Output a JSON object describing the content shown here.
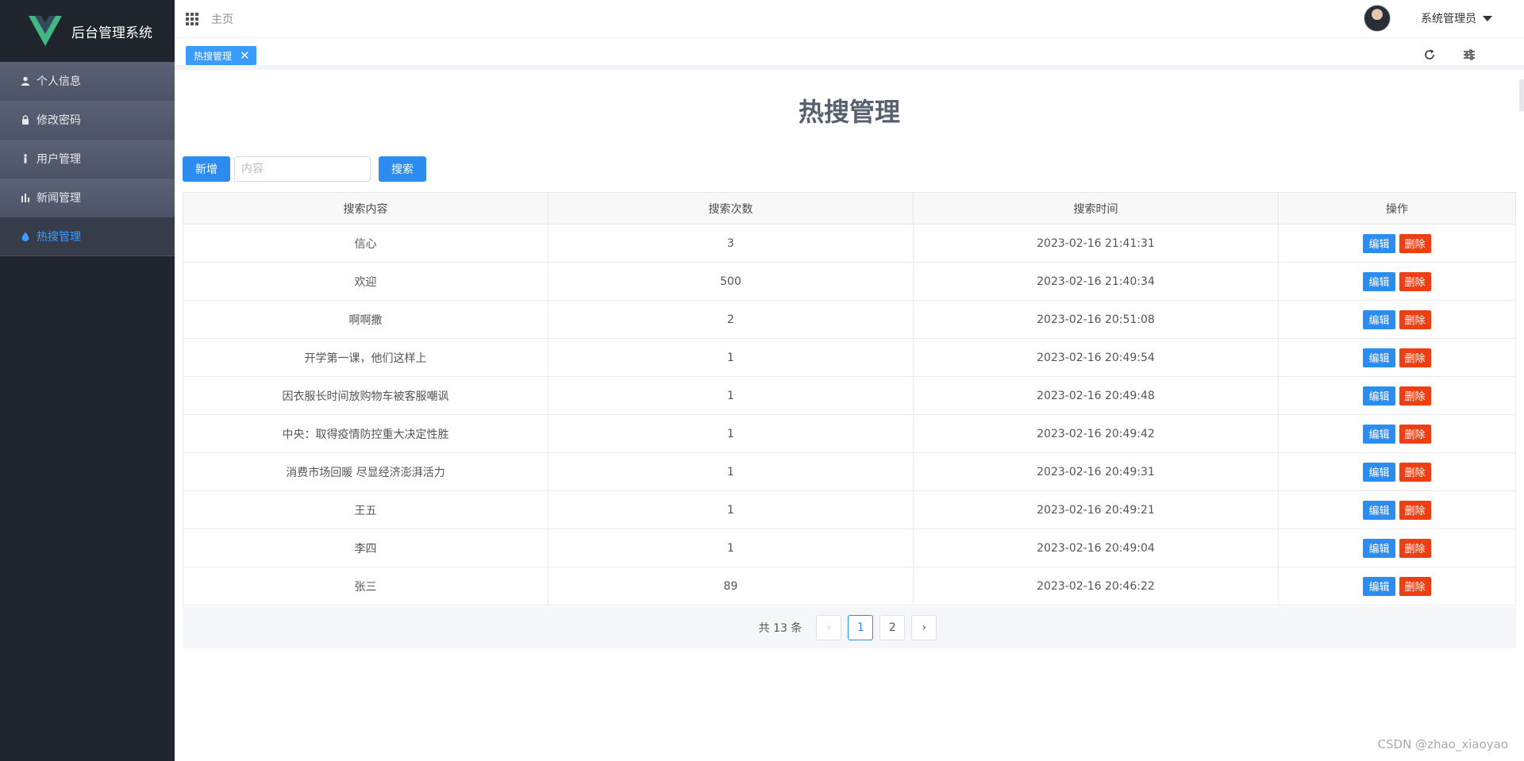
{
  "app": {
    "title": "后台管理系统"
  },
  "sidebar": {
    "items": [
      {
        "label": "个人信息",
        "icon": "person-icon",
        "active": false
      },
      {
        "label": "修改密码",
        "icon": "lock-icon",
        "active": false
      },
      {
        "label": "用户管理",
        "icon": "user-manage-icon",
        "active": false
      },
      {
        "label": "新闻管理",
        "icon": "bar-chart-icon",
        "active": false
      },
      {
        "label": "热搜管理",
        "icon": "droplet-icon",
        "active": true
      }
    ]
  },
  "header": {
    "breadcrumb": "主页",
    "username": "系统管理员"
  },
  "tags": [
    {
      "label": "热搜管理",
      "close": "✕"
    }
  ],
  "main": {
    "title": "热搜管理",
    "add_label": "新增",
    "search_placeholder": "内容",
    "search_label": "搜索",
    "columns": [
      "搜索内容",
      "搜索次数",
      "搜索时间",
      "操作"
    ],
    "edit_label": "编辑",
    "delete_label": "删除",
    "rows": [
      {
        "content": "信心",
        "count": "3",
        "time": "2023-02-16 21:41:31"
      },
      {
        "content": "欢迎",
        "count": "500",
        "time": "2023-02-16 21:40:34"
      },
      {
        "content": "啊啊撒",
        "count": "2",
        "time": "2023-02-16 20:51:08"
      },
      {
        "content": "开学第一课，他们这样上",
        "count": "1",
        "time": "2023-02-16 20:49:54"
      },
      {
        "content": "因衣服长时间放购物车被客服嘲讽",
        "count": "1",
        "time": "2023-02-16 20:49:48"
      },
      {
        "content": "中央：取得疫情防控重大决定性胜",
        "count": "1",
        "time": "2023-02-16 20:49:42"
      },
      {
        "content": "消费市场回暖 尽显经济澎湃活力",
        "count": "1",
        "time": "2023-02-16 20:49:31"
      },
      {
        "content": "王五",
        "count": "1",
        "time": "2023-02-16 20:49:21"
      },
      {
        "content": "李四",
        "count": "1",
        "time": "2023-02-16 20:49:04"
      },
      {
        "content": "张三",
        "count": "89",
        "time": "2023-02-16 20:46:22"
      }
    ]
  },
  "pagination": {
    "total_text": "共 13 条",
    "prev": "‹",
    "next": "›",
    "pages": [
      "1",
      "2"
    ],
    "current": "1"
  },
  "watermark": "CSDN @zhao_xiaoyao",
  "colors": {
    "sidebar_bg": "#21252f",
    "primary": "#2d8cf0",
    "danger": "#ed3f14",
    "active_menu_text": "#3e9bff"
  }
}
